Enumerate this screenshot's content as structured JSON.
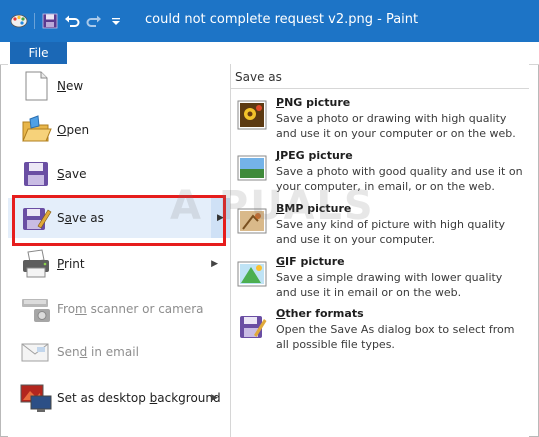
{
  "window": {
    "title": "could not complete request v2.png - Paint",
    "quick_access_icons": [
      "paint-app-icon",
      "save-icon",
      "undo-icon",
      "redo-icon",
      "customize-arrow-icon"
    ]
  },
  "ribbon": {
    "file_tab": "File"
  },
  "menu": {
    "items": [
      {
        "label": "New",
        "underline": "N",
        "icon": "new-document-icon"
      },
      {
        "label": "Open",
        "underline": "O",
        "icon": "open-folder-icon"
      },
      {
        "label": "Save",
        "underline": "S",
        "icon": "save-floppy-icon"
      },
      {
        "label": "Save as",
        "underline": "a",
        "icon": "save-as-icon",
        "selected": true
      },
      {
        "label": "Print",
        "underline": "P",
        "icon": "printer-icon"
      },
      {
        "label": "From scanner or camera",
        "underline": "m",
        "icon": "scanner-icon",
        "disabled": true
      },
      {
        "label": "Send in email",
        "underline": "d",
        "icon": "email-icon",
        "disabled": true
      },
      {
        "label": "Set as desktop background",
        "underline": "b",
        "icon": "desktop-background-icon"
      }
    ]
  },
  "save_as_panel": {
    "title": "Save as",
    "options": [
      {
        "title": "PNG picture",
        "desc": "Save a photo or drawing with high quality and use it on your computer or on the web.",
        "icon": "png-file-icon"
      },
      {
        "title": "JPEG picture",
        "desc": "Save a photo with good quality and use it on your computer, in email, or on the web.",
        "icon": "jpeg-file-icon"
      },
      {
        "title": "BMP picture",
        "desc": "Save any kind of picture with high quality and use it on your computer.",
        "icon": "bmp-file-icon"
      },
      {
        "title": "GIF picture",
        "desc": "Save a simple drawing with lower quality and use it in email or on the web.",
        "icon": "gif-file-icon"
      },
      {
        "title": "Other formats",
        "desc": "Open the Save As dialog box to select from all possible file types.",
        "icon": "other-formats-icon"
      }
    ]
  },
  "watermark": "A  PUALS",
  "colors": {
    "titlebar": "#1d74c6",
    "file_tab": "#1b68b6",
    "highlight": "#e61d1d"
  }
}
